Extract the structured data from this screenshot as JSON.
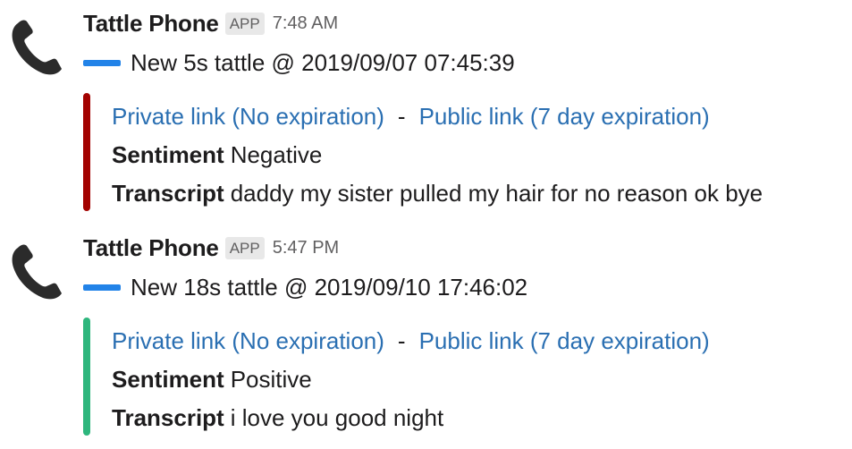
{
  "messages": [
    {
      "sender": "Tattle Phone",
      "badge": "APP",
      "time": "7:48 AM",
      "title": "New 5s tattle @ 2019/09/07 07:45:39",
      "accent_color": "#2283e8",
      "attachment": {
        "bar_color": "#a30200",
        "private_link": "Private link (No expiration)",
        "separator": "-",
        "public_link": "Public link (7 day expiration)",
        "sentiment_label": "Sentiment",
        "sentiment_value": "Negative",
        "transcript_label": "Transcript",
        "transcript_value": "daddy my sister pulled my hair for no reason ok bye"
      }
    },
    {
      "sender": "Tattle Phone",
      "badge": "APP",
      "time": "5:47 PM",
      "title": "New 18s tattle @ 2019/09/10 17:46:02",
      "accent_color": "#2283e8",
      "attachment": {
        "bar_color": "#2eb67d",
        "private_link": "Private link (No expiration)",
        "separator": "-",
        "public_link": "Public link (7 day expiration)",
        "sentiment_label": "Sentiment",
        "sentiment_value": "Positive",
        "transcript_label": "Transcript",
        "transcript_value": "i love you good night"
      }
    }
  ],
  "icons": {
    "avatar": "telephone-receiver-icon"
  }
}
